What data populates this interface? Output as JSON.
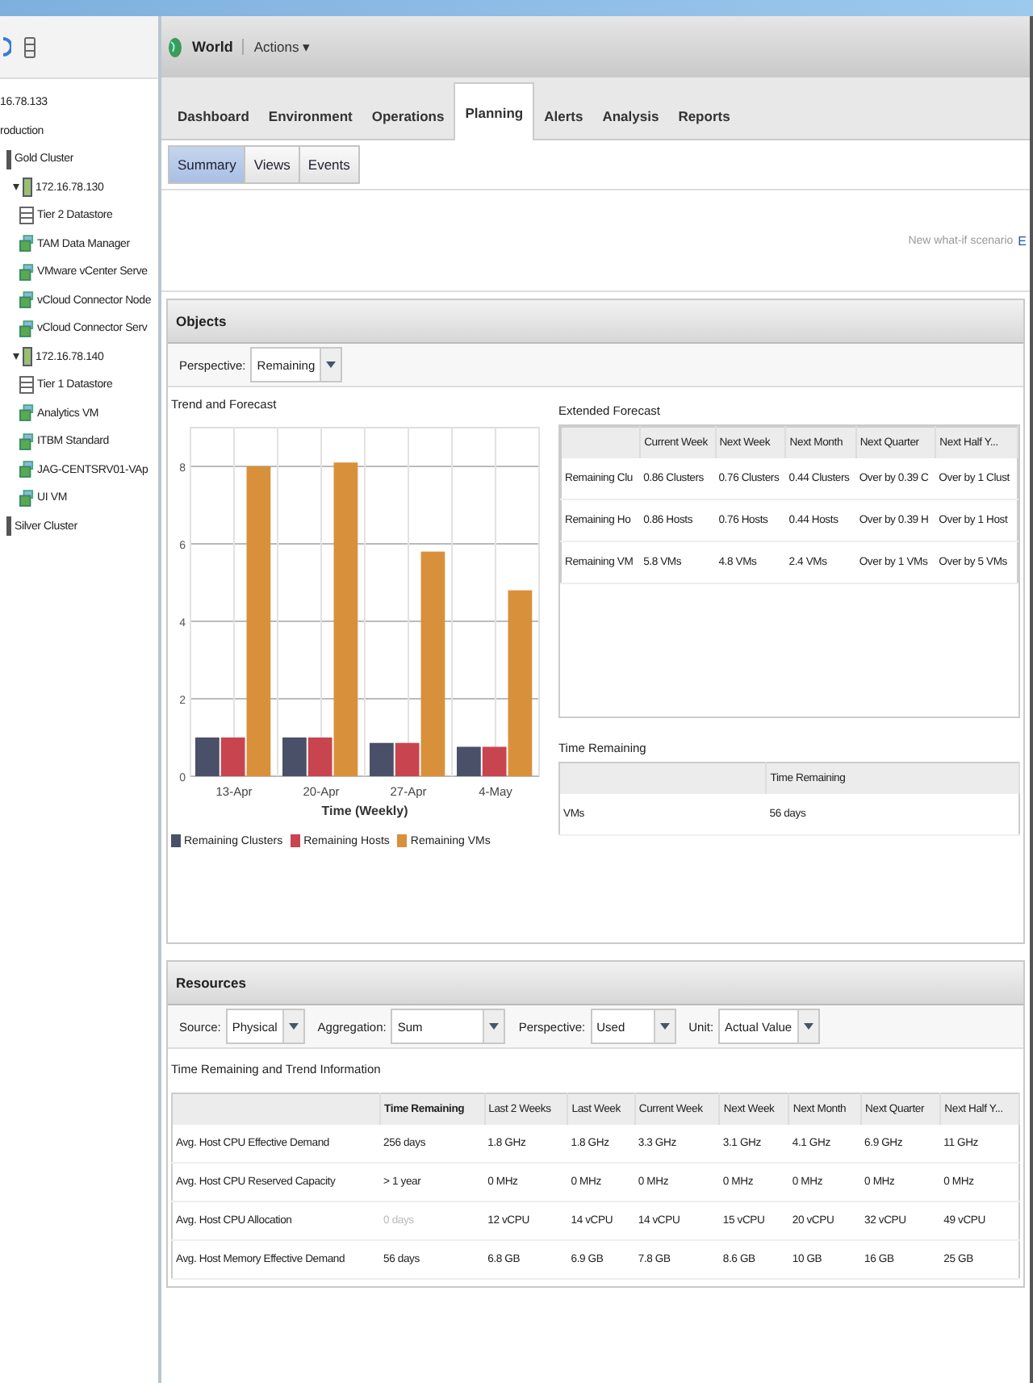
{
  "header": {
    "title": "World",
    "actions": "Actions ▾"
  },
  "sidebar": {
    "items": [
      {
        "label": "16.78.133"
      },
      {
        "label": "roduction",
        "children": [
          {
            "label": "Gold Cluster",
            "kind": "cluster",
            "children": [
              {
                "label": "172.16.78.130",
                "kind": "host",
                "expanded": true,
                "children": [
                  {
                    "label": "Tier 2 Datastore",
                    "kind": "datastore"
                  },
                  {
                    "label": "TAM Data Manager",
                    "kind": "vm"
                  },
                  {
                    "label": "VMware vCenter Serve",
                    "kind": "vm"
                  },
                  {
                    "label": "vCloud Connector Node",
                    "kind": "vm"
                  },
                  {
                    "label": "vCloud Connector Serv",
                    "kind": "vm"
                  }
                ]
              },
              {
                "label": "172.16.78.140",
                "kind": "host",
                "expanded": true,
                "children": [
                  {
                    "label": "Tier 1 Datastore",
                    "kind": "datastore"
                  },
                  {
                    "label": "Analytics VM",
                    "kind": "vm"
                  },
                  {
                    "label": "ITBM Standard",
                    "kind": "vm"
                  },
                  {
                    "label": "JAG-CENTSRV01-VAp",
                    "kind": "vm"
                  },
                  {
                    "label": "UI VM",
                    "kind": "vm"
                  }
                ]
              }
            ]
          },
          {
            "label": "Silver Cluster",
            "kind": "cluster"
          }
        ]
      }
    ]
  },
  "tabs": [
    {
      "label": "Dashboard",
      "selected": false
    },
    {
      "label": "Environment",
      "selected": false
    },
    {
      "label": "Operations",
      "selected": false
    },
    {
      "label": "Planning",
      "selected": true
    },
    {
      "label": "Alerts",
      "selected": false
    },
    {
      "label": "Analysis",
      "selected": false
    },
    {
      "label": "Reports",
      "selected": false
    }
  ],
  "subtabs": [
    {
      "label": "Summary",
      "selected": true
    },
    {
      "label": "Views",
      "selected": false
    },
    {
      "label": "Events",
      "selected": false
    }
  ],
  "scenario": {
    "text": "New what-if scenario",
    "link": "E"
  },
  "objects": {
    "title": "Objects",
    "perspective": {
      "label": "Perspective:",
      "value": "Remaining"
    },
    "trend_title": "Trend and Forecast",
    "chart_data": {
      "type": "bar",
      "xlabel": "Time (Weekly)",
      "grid": true,
      "categories": [
        "13-Apr",
        "20-Apr",
        "27-Apr",
        "4-May"
      ],
      "yticks": [
        0,
        2,
        4,
        6,
        8
      ],
      "ylim": [
        0,
        9
      ],
      "series": [
        {
          "name": "Remaining Clusters",
          "color": "#4a5068",
          "values": [
            1,
            1,
            0.86,
            0.76
          ]
        },
        {
          "name": "Remaining Hosts",
          "color": "#c8454f",
          "values": [
            1,
            1,
            0.86,
            0.76
          ]
        },
        {
          "name": "Remaining VMs",
          "color": "#d8913a",
          "values": [
            8,
            8.1,
            5.8,
            4.8
          ]
        }
      ]
    },
    "extended": {
      "title": "Extended Forecast",
      "columns": [
        "",
        "Current Week",
        "Next Week",
        "Next Month",
        "Next Quarter",
        "Next Half Y..."
      ],
      "rows": [
        [
          "Remaining Clu",
          "0.86 Clusters",
          "0.76 Clusters",
          "0.44 Clusters",
          "Over by 0.39 C",
          "Over by 1 Clust"
        ],
        [
          "Remaining Ho",
          "0.86 Hosts",
          "0.76 Hosts",
          "0.44 Hosts",
          "Over by 0.39 H",
          "Over by 1 Host"
        ],
        [
          "Remaining VM",
          "5.8 VMs",
          "4.8 VMs",
          "2.4 VMs",
          "Over by 1 VMs",
          "Over by 5 VMs"
        ]
      ]
    },
    "remaining": {
      "title": "Time Remaining",
      "columns": [
        "",
        "Time Remaining"
      ],
      "rows": [
        [
          "VMs",
          "56 days"
        ]
      ]
    }
  },
  "resources": {
    "title": "Resources",
    "filters": [
      {
        "label": "Source:",
        "value": "Physical"
      },
      {
        "label": "Aggregation:",
        "value": "Sum"
      },
      {
        "label": "Perspective:",
        "value": "Used"
      },
      {
        "label": "Unit:",
        "value": "Actual Value"
      }
    ],
    "subtitle": "Time Remaining and Trend Information",
    "columns": [
      "Time Remaining",
      "Last 2 Weeks",
      "Last Week",
      "Current Week",
      "Next Week",
      "Next Month",
      "Next Quarter",
      "Next Half Y..."
    ],
    "rows": [
      {
        "name": "Avg. Host CPU Effective Demand",
        "time_remaining": "256 days",
        "greyed": false,
        "values": [
          "1.8 GHz",
          "1.8 GHz",
          "3.3 GHz",
          "3.1 GHz",
          "4.1 GHz",
          "6.9 GHz",
          "11 GHz"
        ]
      },
      {
        "name": "Avg. Host CPU Reserved Capacity",
        "time_remaining": "> 1 year",
        "greyed": false,
        "values": [
          "0 MHz",
          "0 MHz",
          "0 MHz",
          "0 MHz",
          "0 MHz",
          "0 MHz",
          "0 MHz"
        ]
      },
      {
        "name": "Avg. Host CPU Allocation",
        "time_remaining": "0 days",
        "greyed": true,
        "values": [
          "12 vCPU",
          "14 vCPU",
          "14 vCPU",
          "15 vCPU",
          "20 vCPU",
          "32 vCPU",
          "49 vCPU"
        ]
      },
      {
        "name": "Avg. Host Memory Effective Demand",
        "time_remaining": "56 days",
        "greyed": false,
        "values": [
          "6.8 GB",
          "6.9 GB",
          "7.8 GB",
          "8.6 GB",
          "10 GB",
          "16 GB",
          "25 GB"
        ]
      }
    ]
  }
}
